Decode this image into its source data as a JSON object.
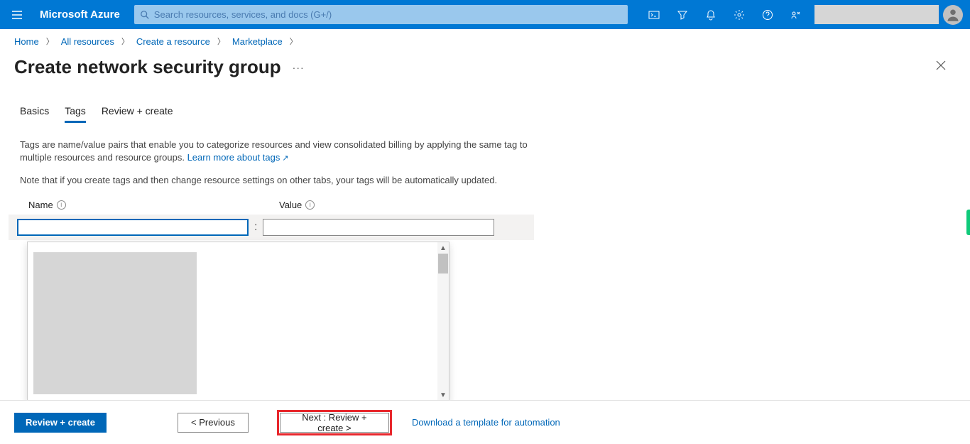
{
  "header": {
    "brand": "Microsoft Azure",
    "search_placeholder": "Search resources, services, and docs (G+/)"
  },
  "breadcrumb": {
    "items": [
      "Home",
      "All resources",
      "Create a resource",
      "Marketplace"
    ]
  },
  "page": {
    "title": "Create network security group",
    "ellipsis": "···"
  },
  "tabs": {
    "items": [
      "Basics",
      "Tags",
      "Review + create"
    ],
    "active_index": 1
  },
  "body": {
    "intro": "Tags are name/value pairs that enable you to categorize resources and view consolidated billing by applying the same tag to multiple resources and resource groups. ",
    "learn_more": "Learn more about tags",
    "note": "Note that if you create tags and then change resource settings on other tabs, your tags will be automatically updated."
  },
  "fields": {
    "name_label": "Name",
    "value_label": "Value",
    "name_value": "",
    "value_value": "",
    "colon": ":"
  },
  "footer": {
    "review_create": "Review + create",
    "previous": "< Previous",
    "next": "Next : Review + create >",
    "download": "Download a template for automation"
  },
  "icons": {
    "search": "search-icon",
    "cloudshell": "cloudshell-icon",
    "directory": "directory-icon",
    "notifications": "bell-icon",
    "settings": "gear-icon",
    "help": "help-icon",
    "feedback": "feedback-icon"
  }
}
